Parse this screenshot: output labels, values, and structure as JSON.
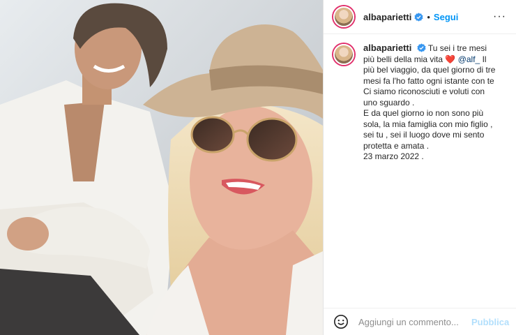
{
  "post": {
    "username": "albaparietti",
    "follow_label": "Segui",
    "separator": "•",
    "more_label": "···"
  },
  "caption": {
    "username": "albaparietti",
    "text_start": "Tu sei i tre mesi più belli della mia vita",
    "heart": "❤️",
    "mention": "@alf_",
    "text_rest": "Il più bel viaggio, da quel giorno di tre mesi fa l'ho fatto ogni istante con te\nCi siamo riconosciuti e voluti con uno sguardo .\nE da quel giorno io non sono più sola, la mia famiglia con mio figlio , sei tu , sei il luogo dove mi sento protetta e amata .\n23 marzo 2022 ."
  },
  "comment_bar": {
    "placeholder": "Aggiungi un commento...",
    "publish_label": "Pubblica"
  },
  "icons": {
    "verified": "verified-badge-icon",
    "emoji": "emoji-smile-icon",
    "more": "more-options-icon"
  },
  "colors": {
    "accent": "#0095f6",
    "verified": "#3897f0",
    "publish_disabled": "#b2dffc",
    "heart": "#ed4956"
  }
}
